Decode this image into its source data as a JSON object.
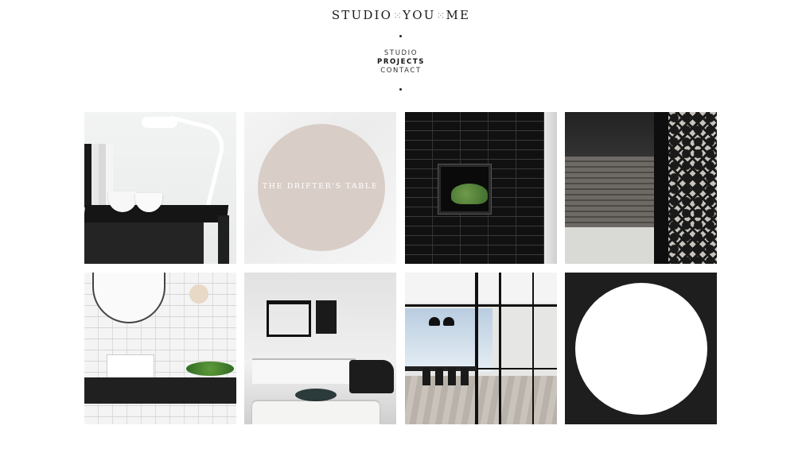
{
  "logo": {
    "part1": "STUDIO",
    "part2": "YOU",
    "part3": "ME",
    "sep": "⁙"
  },
  "nav": {
    "items": [
      {
        "label": "STUDIO",
        "active": false
      },
      {
        "label": "PROJECTS",
        "active": true
      },
      {
        "label": "CONTACT",
        "active": false
      }
    ]
  },
  "projects": {
    "tile2_label": "THE DRIFTER'S TABLE"
  },
  "colors": {
    "accent_circle": "#d8cdc7",
    "background": "#ffffff",
    "text": "#1a1a1a"
  }
}
